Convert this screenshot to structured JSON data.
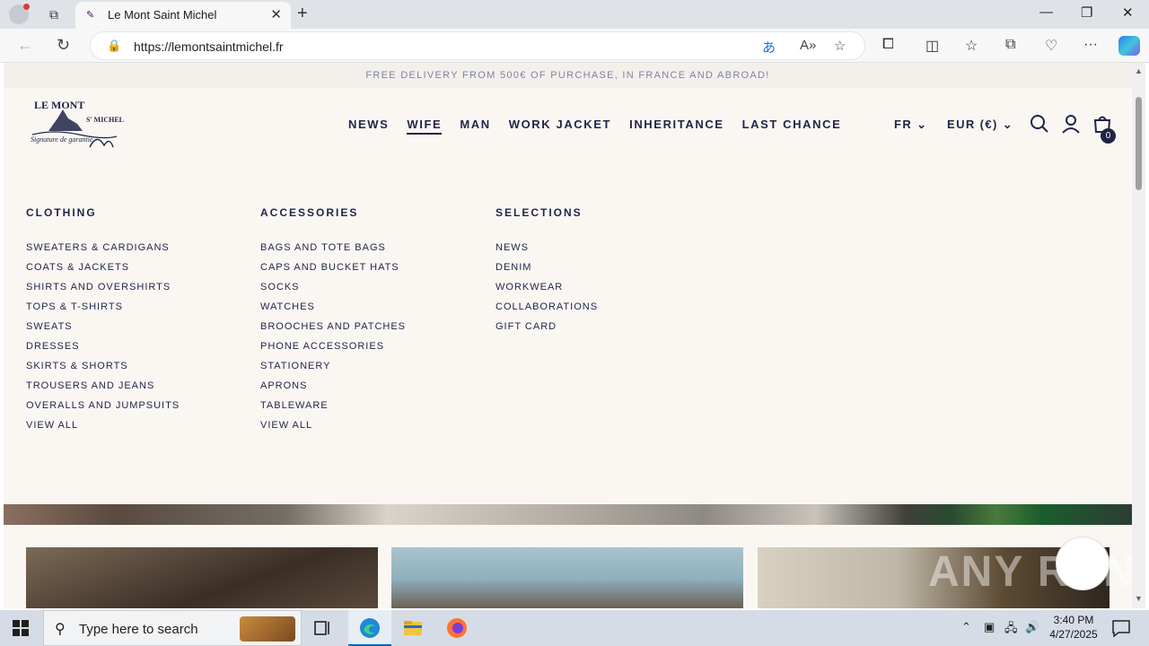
{
  "browser": {
    "tab_title": "Le Mont Saint Michel",
    "url": "https://lemontsaintmichel.fr"
  },
  "page": {
    "promo": "FREE DELIVERY FROM 500€ OF PURCHASE, IN FRANCE AND ABROAD!",
    "logo": {
      "line1": "LE MONT",
      "line2": "S' MICHEL",
      "signature": "Signature de garantie"
    },
    "nav": {
      "items": [
        "NEWS",
        "WIFE",
        "MAN",
        "WORK JACKET",
        "INHERITANCE",
        "LAST CHANCE"
      ],
      "active": "WIFE"
    },
    "language": "FR",
    "currency": "EUR (€)",
    "cart_count": "0",
    "menu": {
      "clothing": {
        "heading": "CLOTHING",
        "items": [
          "SWEATERS & CARDIGANS",
          "COATS & JACKETS",
          "SHIRTS AND OVERSHIRTS",
          "TOPS & T-SHIRTS",
          "SWEATS",
          "DRESSES",
          "SKIRTS & SHORTS",
          "TROUSERS AND JEANS",
          "OVERALLS AND JUMPSUITS",
          "VIEW ALL"
        ]
      },
      "accessories": {
        "heading": "ACCESSORIES",
        "items": [
          "BAGS AND TOTE BAGS",
          "CAPS AND BUCKET HATS",
          "SOCKS",
          "WATCHES",
          "BROOCHES AND PATCHES",
          "PHONE ACCESSORIES",
          "STATIONERY",
          "APRONS",
          "TABLEWARE",
          "VIEW ALL"
        ]
      },
      "selections": {
        "heading": "SELECTIONS",
        "items": [
          "NEWS",
          "DENIM",
          "WORKWEAR",
          "COLLABORATIONS",
          "GIFT CARD"
        ]
      }
    },
    "watermark": "ANY RUN"
  },
  "taskbar": {
    "search_placeholder": "Type here to search",
    "time": "3:40 PM",
    "date": "4/27/2025"
  },
  "colors": {
    "brand_navy": "#1f2448",
    "page_background": "#faf7f3",
    "promo_text": "#7c84a4"
  }
}
